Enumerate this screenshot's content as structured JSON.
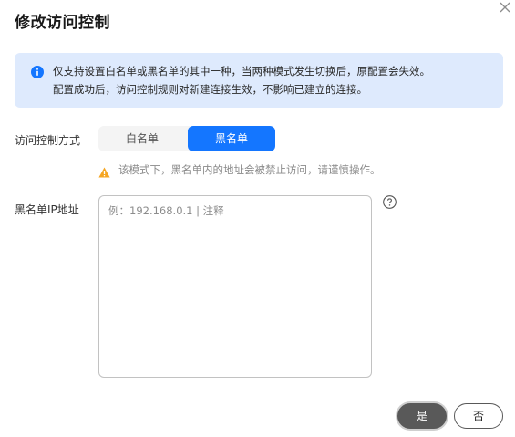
{
  "dialog": {
    "title": "修改访问控制"
  },
  "info": {
    "line1": "仅支持设置白名单或黑名单的其中一种，当两种模式发生切换后，原配置会失效。",
    "line2": "配置成功后，访问控制规则对新建连接生效，不影响已建立的连接。"
  },
  "mode": {
    "label": "访问控制方式",
    "options": [
      "白名单",
      "黑名单"
    ],
    "selected": "黑名单",
    "warning": "该模式下，黑名单内的地址会被禁止访问，请谨慎操作。"
  },
  "ip_list": {
    "label": "黑名单IP地址",
    "placeholder": "例：192.168.0.1 | 注释",
    "value": ""
  },
  "footer": {
    "confirm_label": "是",
    "cancel_label": "否"
  },
  "colors": {
    "accent": "#1476ff",
    "info_bg": "#deeafd",
    "warning": "#f5a623",
    "primary_button": "#595959"
  },
  "icons": {
    "close": "close-icon",
    "info": "info-icon",
    "warning": "warning-icon",
    "help": "help-icon"
  }
}
